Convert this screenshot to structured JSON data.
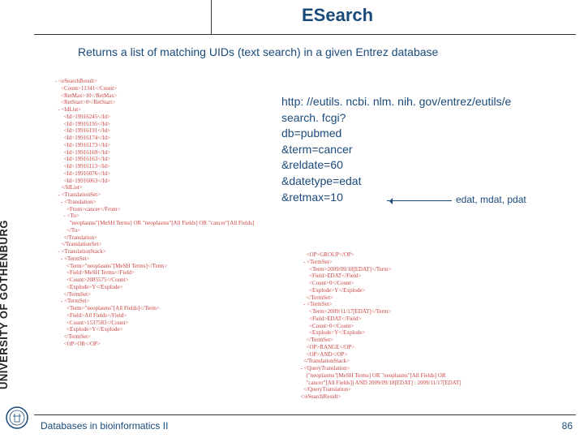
{
  "sidebar": {
    "label": "UNIVERSITY OF GOTHENBURG"
  },
  "header": {
    "title": "ESearch"
  },
  "subtitle": "Returns a list of matching UIDs (text search) in a given Entrez database",
  "url": {
    "line1": "http: //eutils. ncbi. nlm. nih. gov/entrez/eutils/e",
    "line2": "search. fcgi?",
    "line3": "db=pubmed",
    "line4": "&term=cancer",
    "line5": "&reldate=60",
    "line6": "&datetype=edat",
    "line7": "&retmax=10"
  },
  "annotation": "edat, mdat, pdat",
  "xml_left": "- <eSearchResult>\n    <Count>11341</Count>\n    <RetMax>10</RetMax>\n    <RetStart>0</RetStart>\n  - <IdList>\n      <Id>19916245</Id>\n      <Id>19916195</Id>\n      <Id>19916191</Id>\n      <Id>19916174</Id>\n      <Id>19916173</Id>\n      <Id>19916169</Id>\n      <Id>19916163</Id>\n      <Id>19916113</Id>\n      <Id>19916076</Id>\n      <Id>19916063</Id>\n    </IdList>\n  - <TranslationSet>\n    - <Translation>\n        <From>cancer</From>\n      - <To>\n          \"neoplasms\"[MeSH Terms] OR \"neoplasms\"[All Fields] OR \"cancer\"[All Fields]\n        </To>\n      </Translation>\n    </TranslationSet>\n  - <TranslationStack>\n    - <TermSet>\n        <Term>\"neoplasms\"[MeSH Terms]</Term>\n        <Field>MeSH Terms</Field>\n        <Count>2085575</Count>\n        <Explode>Y</Explode>\n      </TermSet>\n    - <TermSet>\n        <Term>\"neoplasms\"[All Fields]</Term>\n        <Field>All Fields</Field>\n        <Count>1537583</Count>\n        <Explode>Y</Explode>\n      </TermSet>\n      <OP>OR</OP>",
  "xml_right": "      <OP>GROUP</OP>\n    - <TermSet>\n        <Term>2009/09/18[EDAT]</Term>\n        <Field>EDAT</Field>\n        <Count>0</Count>\n        <Explode>Y</Explode>\n      </TermSet>\n    - <TermSet>\n        <Term>2009/11/17[EDAT]</Term>\n        <Field>EDAT</Field>\n        <Count>0</Count>\n        <Explode>Y</Explode>\n      </TermSet>\n      <OP>RANGE</OP>\n      <OP>AND</OP>\n    </TranslationStack>\n  - <QueryTranslation>\n      (\"neoplasms\"[MeSH Terms] OR \"neoplasms\"[All Fields] OR\n      \"cancer\"[All Fields]) AND 2009/09/18[EDAT] : 2009/11/17[EDAT]\n    </QueryTranslation>\n  </eSearchResult>",
  "footer": {
    "left": "Databases in bioinformatics II",
    "page": "86"
  }
}
